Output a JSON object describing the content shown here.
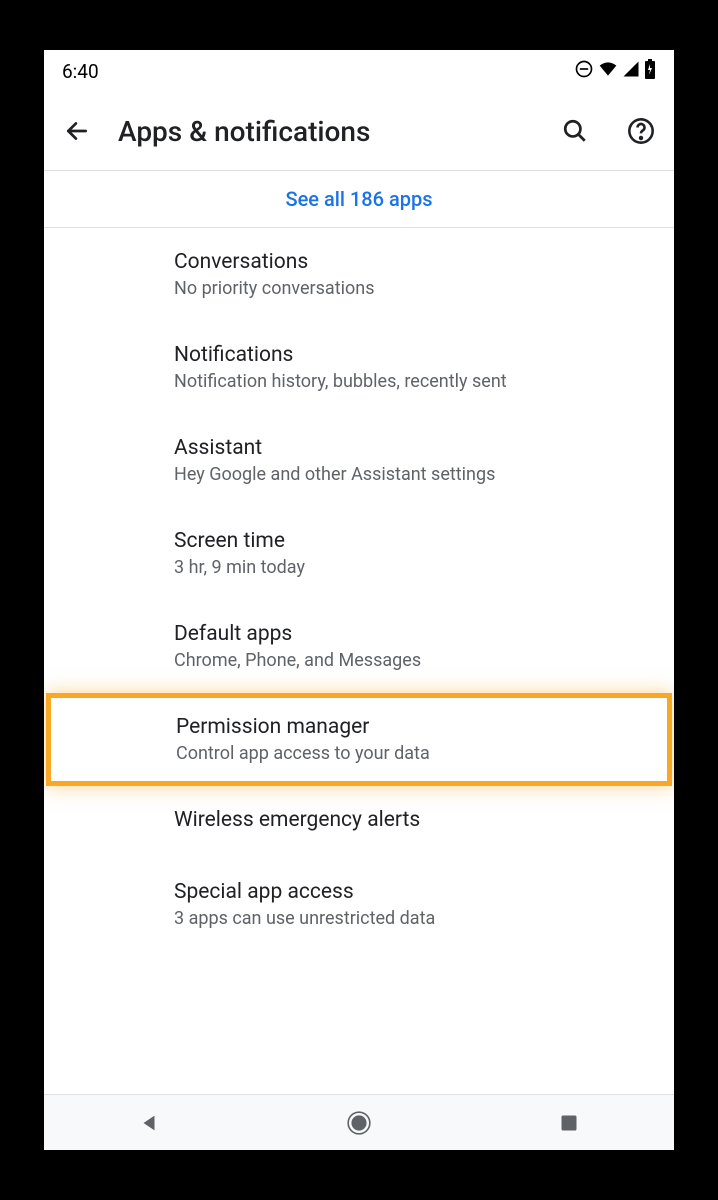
{
  "status": {
    "time": "6:40"
  },
  "header": {
    "title": "Apps & notifications"
  },
  "see_all": "See all 186 apps",
  "items": [
    {
      "title": "Conversations",
      "sub": "No priority conversations"
    },
    {
      "title": "Notifications",
      "sub": "Notification history, bubbles, recently sent"
    },
    {
      "title": "Assistant",
      "sub": "Hey Google and other Assistant settings"
    },
    {
      "title": "Screen time",
      "sub": "3 hr, 9 min today"
    },
    {
      "title": "Default apps",
      "sub": "Chrome, Phone, and Messages"
    },
    {
      "title": "Permission manager",
      "sub": "Control app access to your data"
    },
    {
      "title": "Wireless emergency alerts",
      "sub": ""
    },
    {
      "title": "Special app access",
      "sub": "3 apps can use unrestricted data"
    }
  ]
}
